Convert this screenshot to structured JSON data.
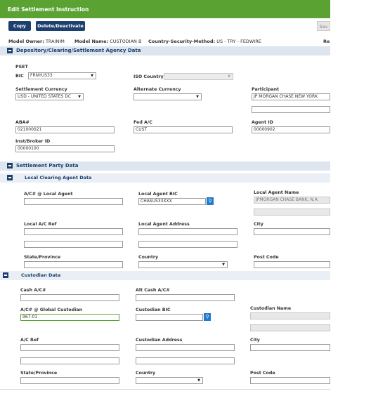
{
  "window": {
    "title": "Edit Settlement Instruction"
  },
  "toolbar": {
    "copy_label": "Copy",
    "delete_label": "Delete/Deactivate",
    "save_label": "Sav"
  },
  "meta": {
    "owner_label": "Model Owner:",
    "owner_value": "TRAINIM",
    "name_label": "Model Name:",
    "name_value": "CUSTODIAN B",
    "csm_label": "Country-Security-Method:",
    "csm_value": "US - TRY - FEDWIRE",
    "right_label": "Re"
  },
  "depository": {
    "title": "Depository/Clearing/Settlement Agency Data",
    "pset_label": "PSET",
    "bic_label": "BIC",
    "bic_value": "FRNYUS33",
    "iso_country_label": "ISO Country",
    "iso_country_value": "",
    "settlement_currency_label": "Settlement Currency",
    "settlement_currency_value": "USD - UNITED STATES DC",
    "alternate_currency_label": "Alternate Currency",
    "alternate_currency_value": "",
    "participant_label": "Participant",
    "participant_value": "JP MORGAN CHASE NEW YORK",
    "participant_value2": "",
    "aba_label": "ABA#",
    "aba_value": "021000021",
    "fed_ac_label": "Fed A/C",
    "fed_ac_value": "CUST",
    "agent_id_label": "Agent ID",
    "agent_id_value": "00000902",
    "inst_broker_label": "Inst/Broker ID",
    "inst_broker_value": "00000100"
  },
  "settlement_party": {
    "title": "Settlement Party Data"
  },
  "local_agent": {
    "title": "Local Clearing Agent Data",
    "ac_label": "A/C# @ Local Agent",
    "ac_value": "",
    "bic_label": "Local Agent BIC",
    "bic_value": "CHASUS33XXX",
    "name_label": "Local Agent Name",
    "name_value": "JPMORGAN CHASE BANK, N.A.",
    "name_value2": "",
    "ref_label": "Local A/C Ref",
    "ref_value": "",
    "ref_value2": "",
    "address_label": "Local Agent Address",
    "address_value": "",
    "address_value2": "",
    "city_label": "City",
    "city_value": "",
    "state_label": "State/Province",
    "state_value": "",
    "country_label": "Country",
    "country_value": "",
    "post_label": "Post Code",
    "post_value": ""
  },
  "custodian": {
    "title": "Custodian Data",
    "cash_label": "Cash A/C#",
    "cash_value": "",
    "alt_cash_label": "Alt Cash A/C#",
    "alt_cash_value": "",
    "global_ac_label": "A/C# @ Global Custodian",
    "global_ac_value": "967-01",
    "bic_label": "Custodian BIC",
    "bic_value": "",
    "name_label": "Custodian Name",
    "name_value": "",
    "name_value2": "",
    "ref_label": "A/C Ref",
    "ref_value": "",
    "ref_value2": "",
    "address_label": "Custodian Address",
    "address_value": "",
    "address_value2": "",
    "city_label": "City",
    "city_value": "",
    "state_label": "State/Province",
    "state_value": "",
    "country_label": "Country",
    "country_value": "",
    "post_label": "Post Code",
    "post_value": ""
  },
  "icons": {
    "search": "search-icon",
    "collapse": "collapse-icon",
    "dropdown": "chevron-down-icon"
  },
  "colors": {
    "title_green": "#5aa332",
    "button_navy": "#1c3f6e",
    "section_bg": "#dde5ef",
    "search_blue": "#1f7ad0"
  }
}
